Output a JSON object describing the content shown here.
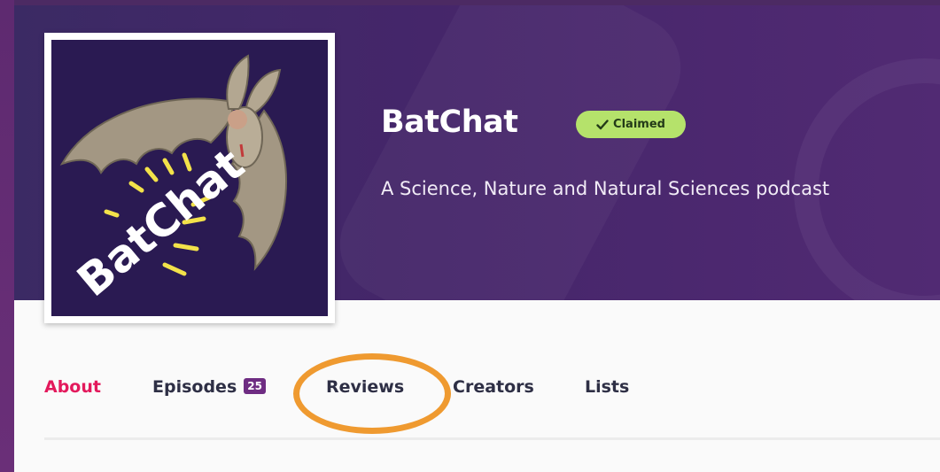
{
  "podcast": {
    "title": "BatChat",
    "claimed_label": "Claimed",
    "description": "A Science, Nature and Natural Sciences podcast",
    "artwork_text": "BatChat"
  },
  "tabs": [
    {
      "label": "About",
      "active": true
    },
    {
      "label": "Episodes",
      "count": "25"
    },
    {
      "label": "Reviews",
      "highlighted": true
    },
    {
      "label": "Creators"
    },
    {
      "label": "Lists"
    }
  ],
  "colors": {
    "accent_active": "#e3195c",
    "badge": "#b5e26b",
    "highlight_circle": "#ef9a30",
    "hero": "#45266a"
  },
  "icons": {
    "badge": "checkmark-icon"
  }
}
